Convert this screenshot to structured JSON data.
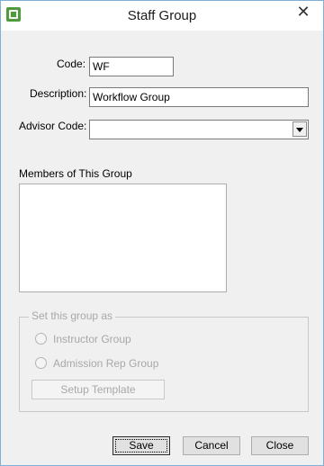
{
  "window": {
    "title": "Staff Group"
  },
  "form": {
    "code_label": "Code:",
    "code_value": "WF",
    "description_label": "Description:",
    "description_value": "Workflow Group",
    "advisor_label": "Advisor Code:",
    "advisor_value": "",
    "members_label": "Members of This Group"
  },
  "group": {
    "legend": "Set this group as",
    "instructor": "Instructor Group",
    "admission": "Admission Rep Group",
    "setup": "Setup Template"
  },
  "buttons": {
    "save": "Save",
    "cancel": "Cancel",
    "close": "Close"
  },
  "icons": {
    "app": "staff-group-app-icon",
    "close": "close-icon",
    "dropdown": "chevron-down-icon"
  }
}
